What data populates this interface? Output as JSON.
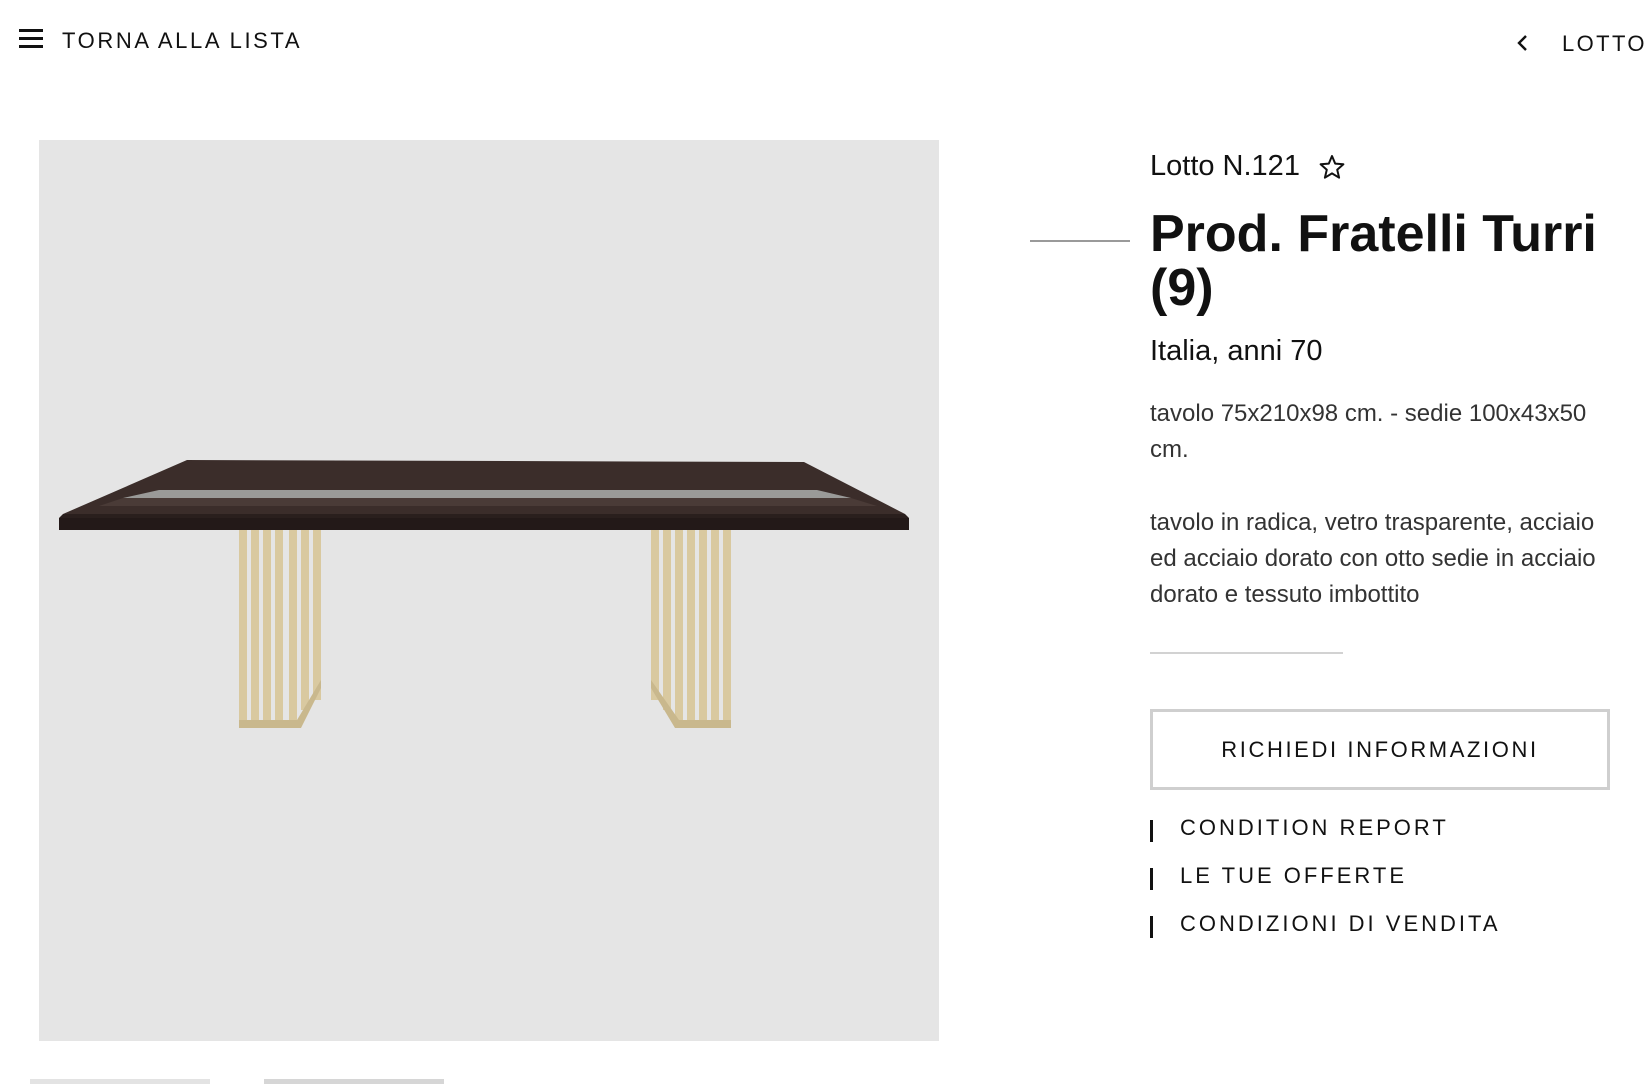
{
  "header": {
    "menu_icon": "hamburger-menu-icon",
    "back_label": "TORNA ALLA LISTA",
    "prev_icon": "chevron-left-icon",
    "nav_label": "LOTTO"
  },
  "lot": {
    "number_label": "Lotto N.121",
    "favorite_icon": "star-outline-icon",
    "title": "Prod. Fratelli Turri (9)",
    "subtitle": "Italia, anni 70",
    "dimensions": "tavolo 75x210x98 cm. - sedie 100x43x50 cm.",
    "description": "tavolo in radica, vetro trasparente, acciaio ed acciaio dorato con otto sedie in acciaio dorato e tessuto imbottito"
  },
  "actions": {
    "request_info_label": "RICHIEDI INFORMAZIONI",
    "links": [
      {
        "label": "CONDITION REPORT"
      },
      {
        "label": "LE TUE OFFERTE"
      },
      {
        "label": "CONDIZIONI DI VENDITA"
      }
    ]
  },
  "image": {
    "background_color": "#e5e5e5",
    "thumbnail_count": 2
  },
  "colors": {
    "text": "#111111",
    "muted_text": "#333333",
    "table_top": "#2e2220",
    "brass": "#d9c9a0",
    "glass_stripe": "#9a9a98"
  }
}
